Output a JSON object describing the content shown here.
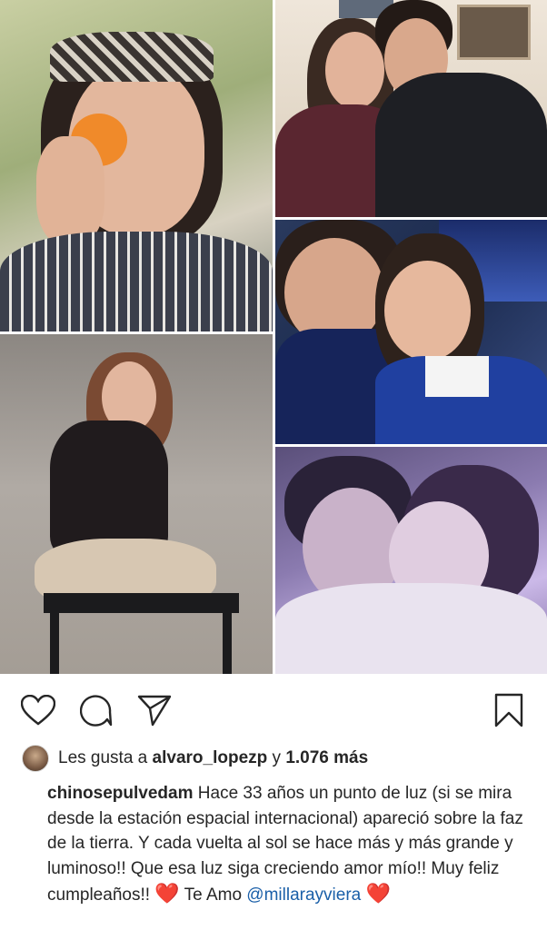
{
  "post": {
    "likes": {
      "prefix": "Les gusta a",
      "user": "alvaro_lopezp",
      "conjunction": "y",
      "count": "1.076 más"
    },
    "caption": {
      "username": "chinosepulvedam",
      "text": "Hace 33 años un punto de luz (si se mira desde la estación espacial internacional) apareció sobre la faz de la tierra. Y cada vuelta al sol se hace más y más grande y luminoso!! Que esa luz siga creciendo amor mío!! Muy feliz cumpleaños!!",
      "heart1": "❤️",
      "text2": "Te Amo",
      "mention": "@millarayviera",
      "heart2": "❤️"
    }
  },
  "icons": {
    "like": "heart-outline-icon",
    "comment": "comment-bubble-icon",
    "share": "paper-plane-icon",
    "save": "bookmark-icon"
  },
  "colors": {
    "text": "#262626",
    "mention": "#1a5fa8",
    "heart": "#e0262c"
  }
}
